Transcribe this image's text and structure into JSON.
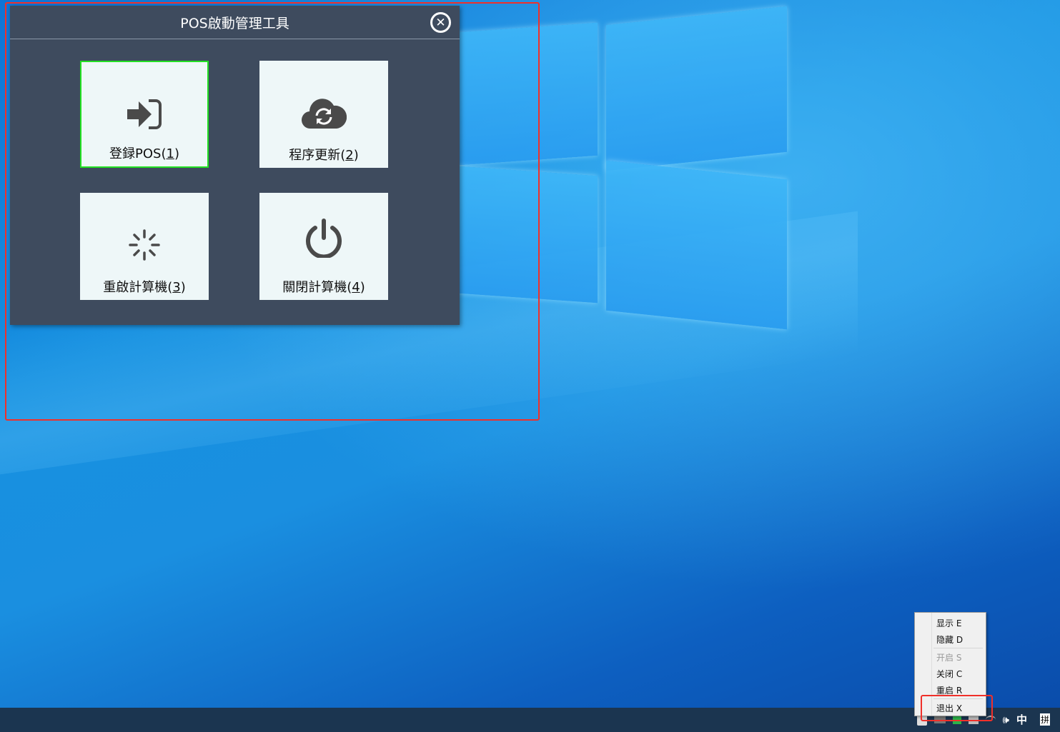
{
  "dialog": {
    "title": "POS啟動管理工具",
    "close_icon": "close-circle-icon",
    "tiles": [
      {
        "name": "登録POS(",
        "key": "1",
        "icon": "sign-in-icon"
      },
      {
        "name": "程序更新(",
        "key": "2",
        "icon": "cloud-sync-icon"
      },
      {
        "name": "重啟計算機(",
        "key": "3",
        "icon": "spinner-icon"
      },
      {
        "name": "關閉計算機(",
        "key": "4",
        "icon": "power-icon"
      }
    ]
  },
  "context_menu": {
    "items": [
      {
        "label": "显示 E",
        "enabled": true
      },
      {
        "label": "隐藏 D",
        "enabled": true
      },
      {
        "label": "开启 S",
        "enabled": false
      },
      {
        "label": "关闭 C",
        "enabled": true
      },
      {
        "label": "重启 R",
        "enabled": true
      },
      {
        "label": "退出 X",
        "enabled": true
      }
    ]
  },
  "taskbar": {
    "volume": "🕪",
    "ime_lang": "中",
    "ime_mode": "拼"
  },
  "colors": {
    "highlight": "#f0302a",
    "selected_tile": "#22e022",
    "dialog_bg": "#3e4b5e"
  },
  "pe": ")"
}
